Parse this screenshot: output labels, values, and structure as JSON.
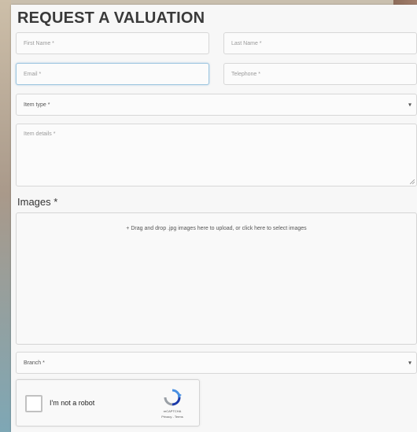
{
  "form": {
    "title": "REQUEST A VALUATION",
    "first_name_placeholder": "First Name *",
    "last_name_placeholder": "Last Name *",
    "email_placeholder": "Email *",
    "telephone_placeholder": "Telephone *",
    "item_type_value": "Item type *",
    "item_details_placeholder": "Item details *",
    "images_label": "Images *",
    "dropzone_text": "+ Drag and drop .jpg images here to upload, or click here to select images",
    "branch_value": "Branch *"
  },
  "captcha": {
    "label": "I'm not a robot",
    "brand": "reCAPTCHA",
    "terms": "Privacy - Terms"
  },
  "icons": {
    "chevron": "chevron-down-icon",
    "captcha_logo": "recaptcha-logo-icon",
    "resize": "resize-handle-icon"
  }
}
